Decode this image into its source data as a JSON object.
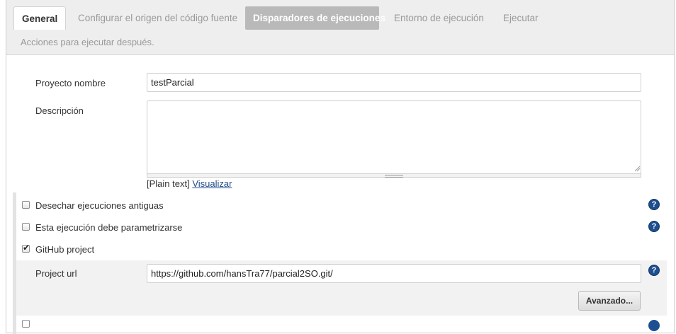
{
  "tabs": [
    {
      "label": "General"
    },
    {
      "label": "Configurar el origen del código fuente"
    },
    {
      "label": "Disparadores de ejecuciones"
    },
    {
      "label": "Entorno de ejecución"
    },
    {
      "label": "Ejecutar"
    }
  ],
  "tabs_row2": {
    "label": "Acciones para ejecutar después."
  },
  "form": {
    "project_name_label": "Proyecto nombre",
    "project_name_value": "testParcial",
    "description_label": "Descripción",
    "description_value": "",
    "markup_prefix": "[Plain text]",
    "preview_link": "Visualizar"
  },
  "options": {
    "discard_old": {
      "label": "Desechar ejecuciones antiguas",
      "checked": false
    },
    "parameterized": {
      "label": "Esta ejecución debe parametrizarse",
      "checked": false
    },
    "github_project": {
      "label": "GitHub project",
      "checked": true,
      "tick": "✔"
    }
  },
  "github": {
    "url_label": "Project url",
    "url_value": "https://github.com/hansTra77/parcial2SO.git/",
    "advanced_button": "Avanzado..."
  },
  "help_glyph": "?",
  "icons": {
    "help": "help-circle-icon",
    "checkbox": "checkbox-icon",
    "resize": "resize-grip-icon"
  },
  "colors": {
    "selected_tab_bg": "#b9b9b9",
    "help_icon": "#1d4f91",
    "link": "#204a87"
  }
}
